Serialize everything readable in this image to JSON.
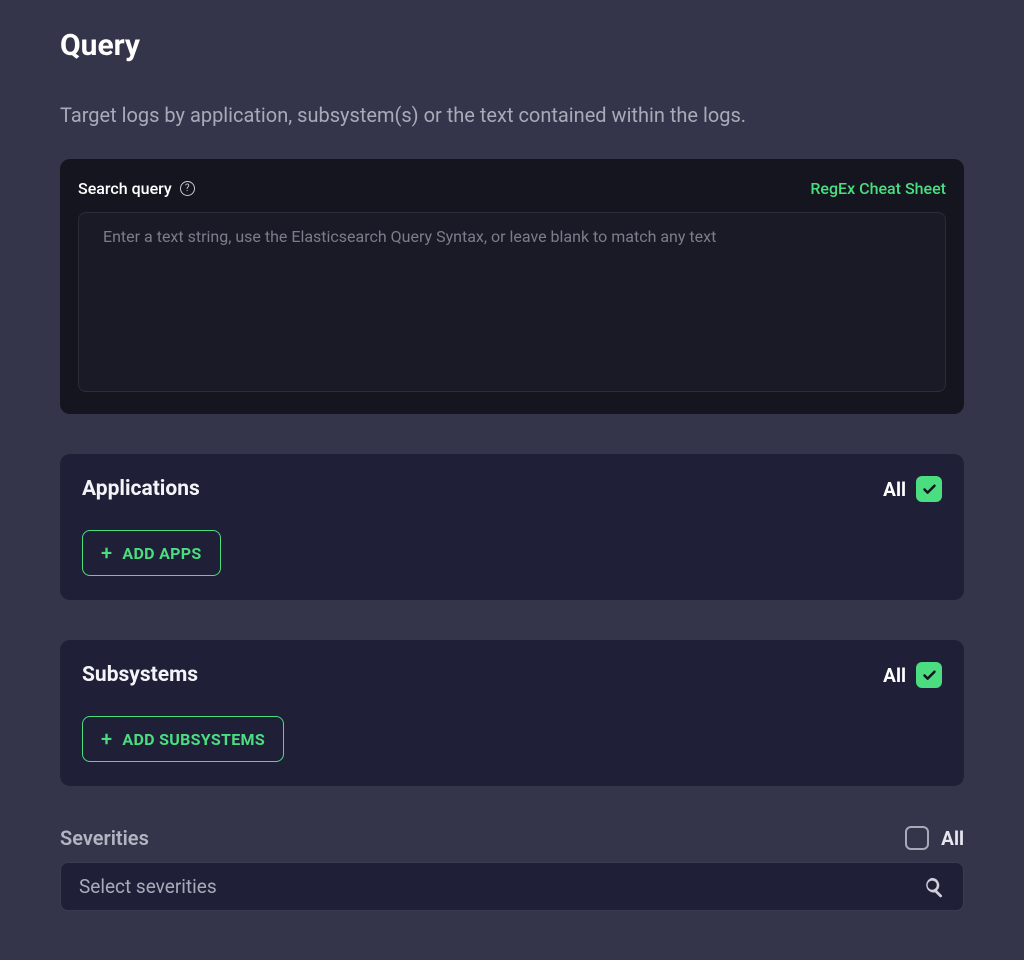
{
  "page": {
    "title": "Query",
    "subtitle": "Target logs by application, subsystem(s) or the text contained within the logs."
  },
  "search": {
    "label": "Search query",
    "placeholder": "Enter a text string, use the Elasticsearch Query Syntax, or leave blank to match any text",
    "value": "",
    "regex_link": "RegEx Cheat Sheet"
  },
  "applications": {
    "title": "Applications",
    "all_label": "All",
    "all_checked": true,
    "add_button": "ADD APPS"
  },
  "subsystems": {
    "title": "Subsystems",
    "all_label": "All",
    "all_checked": true,
    "add_button": "ADD SUBSYSTEMS"
  },
  "severities": {
    "title": "Severities",
    "all_label": "All",
    "all_checked": false,
    "placeholder": "Select severities"
  },
  "colors": {
    "accent": "#4ade80",
    "bg": "#34354a",
    "panel": "#1f2037",
    "panel_dark": "#15151f"
  }
}
